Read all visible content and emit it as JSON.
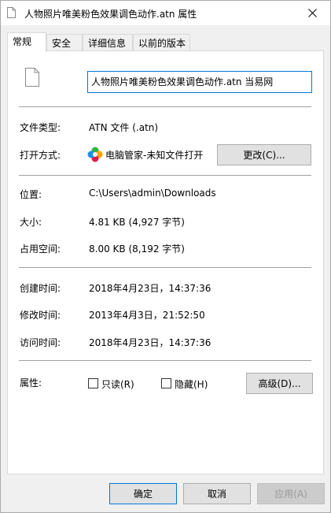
{
  "window": {
    "title": "人物照片唯美粉色效果调色动作.atn 属性"
  },
  "tabs": [
    {
      "label": "常规",
      "active": true
    },
    {
      "label": "安全",
      "active": false
    },
    {
      "label": "详细信息",
      "active": false
    },
    {
      "label": "以前的版本",
      "active": false
    }
  ],
  "general": {
    "filename": "人物照片唯美粉色效果调色动作.atn  当易网",
    "file_type_label": "文件类型:",
    "file_type_value": "ATN 文件 (.atn)",
    "open_with_label": "打开方式:",
    "open_with_value": "电脑管家-未知文件打开",
    "change_button": "更改(C)...",
    "location_label": "位置:",
    "location_value": "C:\\Users\\admin\\Downloads",
    "size_label": "大小:",
    "size_value": "4.81 KB (4,927 字节)",
    "size_on_disk_label": "占用空间:",
    "size_on_disk_value": "8.00 KB (8,192 字节)",
    "created_label": "创建时间:",
    "created_value": "2018年4月23日，14:37:36",
    "modified_label": "修改时间:",
    "modified_value": "2013年4月3日，21:52:50",
    "accessed_label": "访问时间:",
    "accessed_value": "2018年4月23日，14:37:36",
    "attributes_label": "属性:",
    "readonly_label": "只读(R)",
    "hidden_label": "隐藏(H)",
    "advanced_button": "高级(D)..."
  },
  "footer": {
    "ok": "确定",
    "cancel": "取消",
    "apply": "应用(A)"
  },
  "colors": {
    "accent": "#0078d7",
    "panel_bg": "#ffffff",
    "window_bg": "#f0f0f0"
  }
}
